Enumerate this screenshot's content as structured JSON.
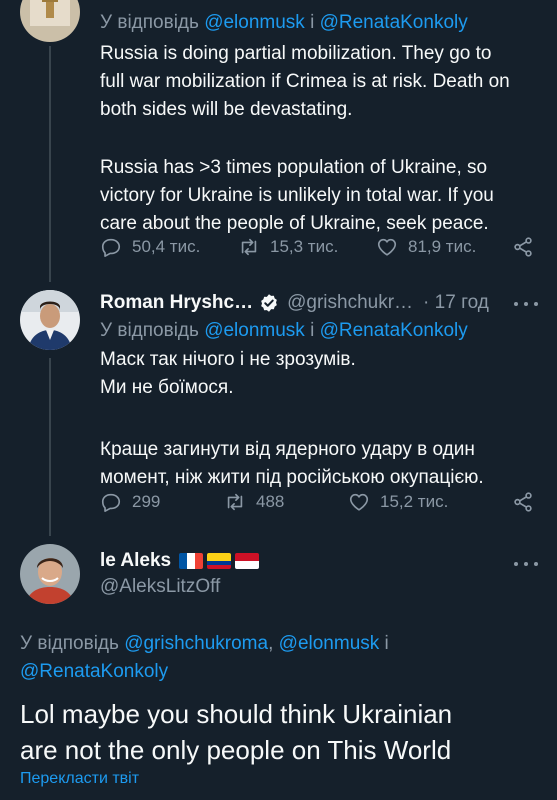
{
  "tweet1": {
    "reply_prefix": "У відповідь ",
    "reply_mention1": "@elonmusk",
    "reply_joiner": " і ",
    "reply_mention2": "@RenataKonkoly",
    "lines": [
      "Russia is doing partial mobilization. They go to",
      "full war mobilization if Crimea is at risk. Death on",
      "both sides will be devastating.",
      "",
      "Russia has >3 times population of Ukraine, so",
      "victory for Ukraine is unlikely in total war. If you",
      "care about the people of Ukraine, seek peace."
    ],
    "replies": "50,4 тис.",
    "retweets": "15,3 тис.",
    "likes": "81,9 тис."
  },
  "tweet2": {
    "name": "Roman Hryshc…",
    "handle": "@grishchukr…",
    "time": "· 17 год",
    "reply_prefix": "У відповідь ",
    "reply_mention1": "@elonmusk",
    "reply_joiner": " і ",
    "reply_mention2": "@RenataKonkoly",
    "lines": [
      "Маск так нічого і не зрозумів.",
      "Ми не боїмося.",
      "",
      "Краще загинути від ядерного удару в один",
      "момент, ніж жити під російською окупацією."
    ],
    "replies": "299",
    "retweets": "488",
    "likes": "15,2 тис."
  },
  "tweet3": {
    "name": "le Aleks",
    "handle": "@AleksLitzOff",
    "reply_prefix": "У відповідь ",
    "reply_mention1": "@grishchukroma",
    "reply_sep": ", ",
    "reply_mention2": "@elonmusk",
    "reply_joiner": " і",
    "reply_mention3": "@RenataKonkoly",
    "text_line1": "Lol maybe you should think Ukrainian",
    "text_line2": "are not the only people on This World",
    "translate": "Перекласти твіт"
  },
  "colors": {
    "background": "#15202b",
    "text": "#f7f9f9",
    "secondary": "#8b98a5",
    "accent": "#1d9bf0",
    "divider": "#38444d",
    "verified": "#1d9bf0"
  },
  "icons": [
    "reply-icon",
    "retweet-icon",
    "like-icon",
    "share-icon",
    "verified-badge-icon",
    "more-icon",
    "flag-fr",
    "flag-co",
    "flag-id"
  ]
}
